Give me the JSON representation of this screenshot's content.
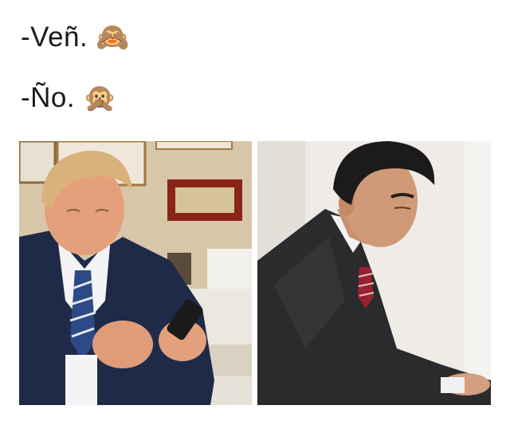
{
  "caption": {
    "line1": {
      "text": "-Veñ.",
      "emoji": "🙈",
      "emoji_icon": "see-no-evil-monkey-icon"
    },
    "line2": {
      "text": "-Ño.",
      "emoji": "🙊",
      "emoji_icon": "speak-no-evil-monkey-icon"
    }
  },
  "photos": [
    {
      "id": "left",
      "subject": "man-texting-on-phone"
    },
    {
      "id": "right",
      "subject": "man-looking-down"
    }
  ],
  "colors": {
    "background": "#ffffff",
    "text": "#1a1a1a"
  }
}
